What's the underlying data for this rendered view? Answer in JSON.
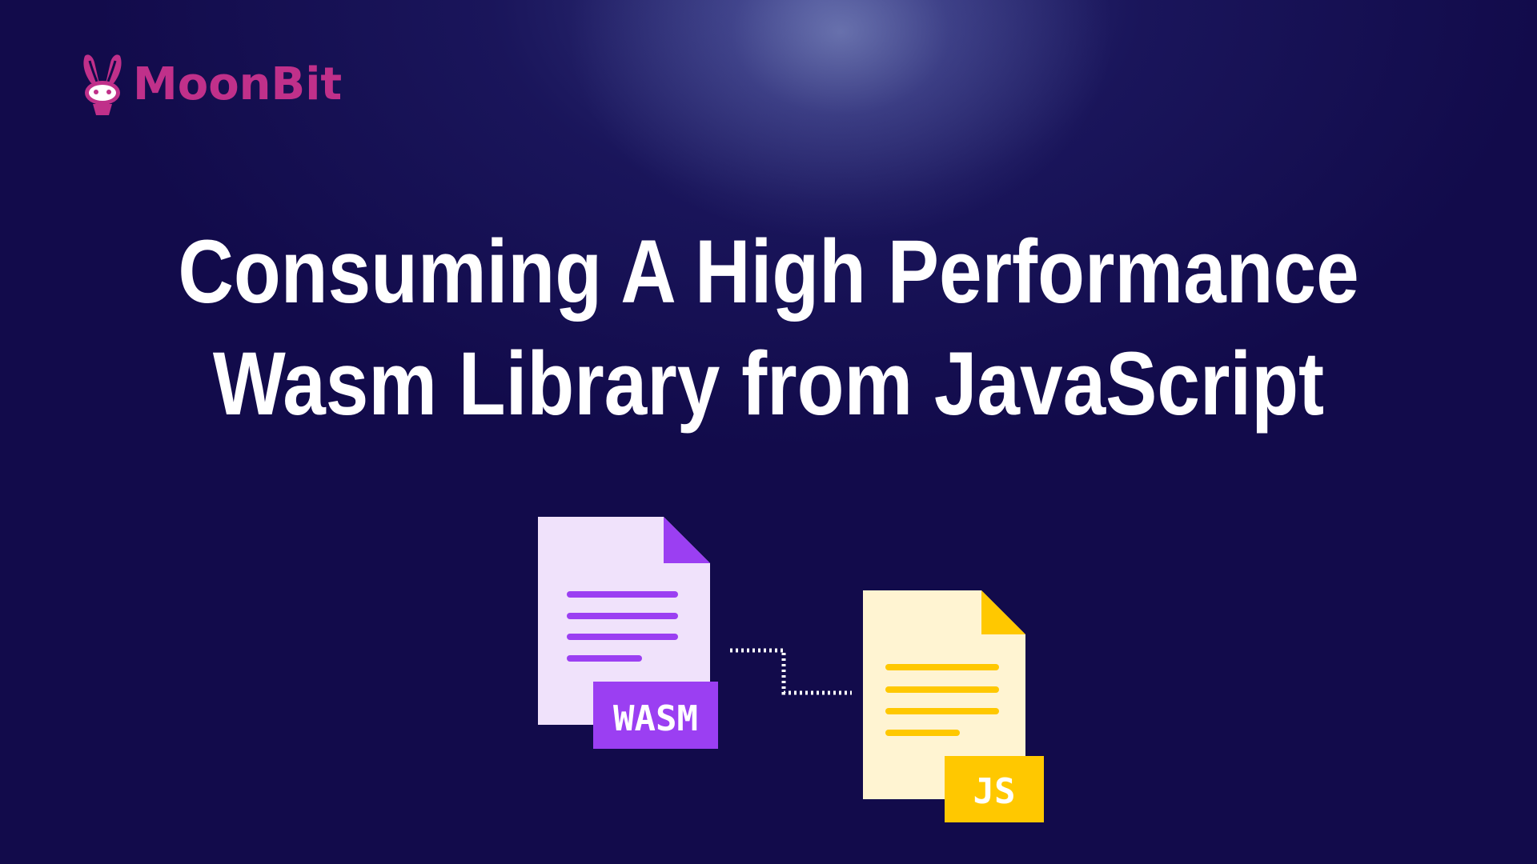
{
  "brand": {
    "name": "MoonBit",
    "color": "#c0308a",
    "icon": "rabbit-logo-icon"
  },
  "title": {
    "line1": "Consuming A High Performance",
    "line2": "Wasm Library from JavaScript"
  },
  "illustration": {
    "wasm_file": {
      "badge": "WASM",
      "icon": "document-icon",
      "page_color": "#f0e2fb",
      "accent_color": "#9b3ff2"
    },
    "js_file": {
      "badge": "JS",
      "icon": "document-icon",
      "page_color": "#fff4d2",
      "accent_color": "#ffc800"
    },
    "connector": "dotted-connector",
    "connector_color": "#ffffff"
  },
  "colors": {
    "background": "#120b4b",
    "title_text": "#ffffff"
  }
}
